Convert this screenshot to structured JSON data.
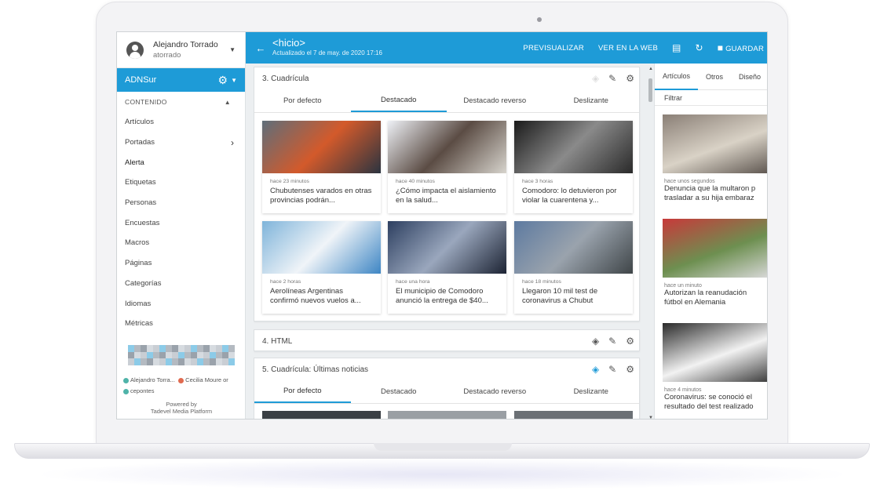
{
  "user": {
    "name": "Alejandro Torrado",
    "login": "atorrado"
  },
  "site": {
    "name": "ADNSur"
  },
  "menu": {
    "section": "CONTENIDO",
    "items": [
      "Artículos",
      "Portadas",
      "Alerta",
      "Etiquetas",
      "Personas",
      "Encuestas",
      "Macros",
      "Páginas",
      "Categorías",
      "Idiomas",
      "Métricas"
    ]
  },
  "online": {
    "user1": "Alejandro Torra...",
    "user2": "Cecilia Moure or",
    "user3": "cepontes"
  },
  "powered": {
    "line1": "Powered by",
    "line2": "Tadevel Media Platform"
  },
  "topbar": {
    "title": "<hicio>",
    "updated": "Actualizado el 7 de may. de 2020 17:16",
    "preview": "PREVISUALIZAR",
    "view_web": "VER EN LA WEB",
    "save": "GUARDAR"
  },
  "panels": {
    "grid1": {
      "title": "3. Cuadrícula",
      "tabs": [
        "Por defecto",
        "Destacado",
        "Destacado reverso",
        "Deslizante"
      ],
      "active_tab": "Destacado",
      "cards": [
        {
          "time": "hace 23 minutos",
          "headline": "Chubutenses varados en otras provincias podrán...",
          "colors": [
            "#5e6e7a",
            "#d35a2b",
            "#2b3440"
          ]
        },
        {
          "time": "hace 40 minutos",
          "headline": "¿Cómo impacta el aislamiento en la salud...",
          "colors": [
            "#eef1f6",
            "#5b4c44",
            "#d7d4cd"
          ]
        },
        {
          "time": "hace 3 horas",
          "headline": "Comodoro: lo detuvieron por violar la cuarentena y...",
          "colors": [
            "#1a1a1a",
            "#8a8a8a",
            "#2a2a2a"
          ]
        },
        {
          "time": "hace 2 horas",
          "headline": "Aerolíneas Argentinas confirmó nuevos vuelos a...",
          "colors": [
            "#7fb4da",
            "#f0f4f8",
            "#3e86c4"
          ]
        },
        {
          "time": "hace una hora",
          "headline": "El municipio de Comodoro anunció la entrega de $40...",
          "colors": [
            "#2d3f60",
            "#9aa7bd",
            "#1c2333"
          ]
        },
        {
          "time": "hace 18 minutos",
          "headline": "Llegaron 10 mil test de coronavirus a Chubut",
          "colors": [
            "#5d7aa0",
            "#9aa3ad",
            "#3f4548"
          ]
        }
      ]
    },
    "html": {
      "title": "4. HTML"
    },
    "grid2": {
      "title": "5. Cuadrícula: Últimas noticias",
      "tabs": [
        "Por defecto",
        "Destacado",
        "Destacado reverso",
        "Deslizante"
      ],
      "active_tab": "Por defecto"
    }
  },
  "right": {
    "tabs": [
      "Artículos",
      "Otros",
      "Diseño"
    ],
    "active_tab": "Artículos",
    "filter": "Filtrar",
    "cards": [
      {
        "time": "hace unos segundos",
        "line1": "Denuncia que la multaron p",
        "line2": "trasladar a su hija embaraz",
        "colors": [
          "#8a7f76",
          "#d9d2c6",
          "#5e5650"
        ]
      },
      {
        "time": "hace un minuto",
        "line1": "Autorizan la reanudación",
        "line2": "fútbol en Alemania",
        "colors": [
          "#c8393a",
          "#6d8f50",
          "#d8d8d8"
        ]
      },
      {
        "time": "hace 4 minutos",
        "line1": "Coronavirus: se conoció el",
        "line2": "resultado del test realizado",
        "colors": [
          "#2a2a2a",
          "#f2f2f2",
          "#3c3c3c"
        ]
      }
    ]
  },
  "colors": {
    "accent": "#1e9bd7",
    "background": "#eceff1"
  }
}
